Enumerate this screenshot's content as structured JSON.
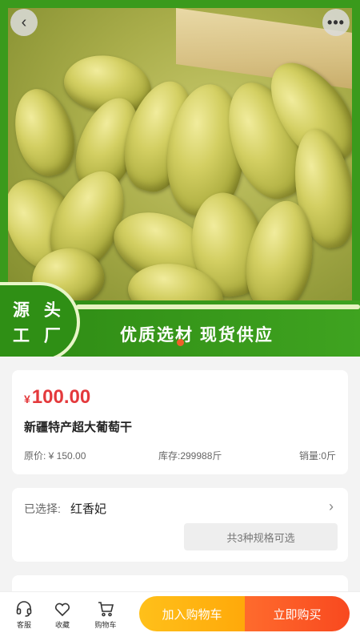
{
  "hero": {
    "badge_text": "源 头 工 厂",
    "slogan": "优质选材  现货供应"
  },
  "nav": {
    "back_icon": "‹",
    "more_icon": "•••"
  },
  "product": {
    "currency": "¥",
    "price": "100.00",
    "name": "新疆特产超大葡萄干",
    "original_price": "原价: ¥ 150.00",
    "stock": "库存:299988斤",
    "sold": "销量:0斤"
  },
  "spec": {
    "label": "已选择:",
    "value": "红香妃",
    "options_text": "共3种规格可选"
  },
  "bottom_bar": {
    "service_label": "客服",
    "favorite_label": "收藏",
    "cart_label": "购物车",
    "add_to_cart": "加入购物车",
    "buy_now": "立即购买"
  },
  "colors": {
    "price": "#e4393c",
    "add_to_cart": "#ffb411",
    "buy_now": "#f8491f",
    "banner_green": "#3a9a1c"
  }
}
